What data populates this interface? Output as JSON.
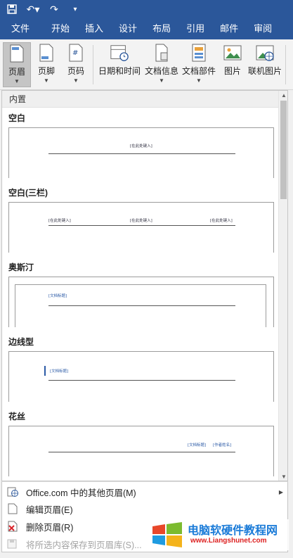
{
  "quick_access": {
    "save_icon": "save-icon",
    "undo_symbol": "↶▾",
    "redo_symbol": "↷",
    "customize_symbol": "▾"
  },
  "tabs": [
    "文件",
    "开始",
    "插入",
    "设计",
    "布局",
    "引用",
    "邮件",
    "审阅"
  ],
  "ribbon": {
    "buttons": [
      {
        "label": "页眉",
        "icon": "header-icon",
        "dropdown": true,
        "selected": true
      },
      {
        "label": "页脚",
        "icon": "footer-icon",
        "dropdown": true,
        "selected": false
      },
      {
        "label": "页码",
        "icon": "page-number-icon",
        "dropdown": true,
        "selected": false
      },
      {
        "label": "日期和时间",
        "icon": "date-time-icon",
        "dropdown": false,
        "selected": false
      },
      {
        "label": "文档信息",
        "icon": "document-info-icon",
        "dropdown": true,
        "selected": false
      },
      {
        "label": "文档部件",
        "icon": "quick-parts-icon",
        "dropdown": true,
        "selected": false
      },
      {
        "label": "图片",
        "icon": "picture-icon",
        "dropdown": false,
        "selected": false
      },
      {
        "label": "联机图片",
        "icon": "online-picture-icon",
        "dropdown": false,
        "selected": false
      }
    ]
  },
  "gallery": {
    "section_header": "内置",
    "items": [
      {
        "name": "空白",
        "placeholders": [
          "[在此处键入]"
        ]
      },
      {
        "name": "空白(三栏)",
        "placeholders": [
          "[在此处键入]",
          "[在此处键入]",
          "[在此处键入]"
        ]
      },
      {
        "name": "奥斯汀",
        "placeholders": [
          "[文档标题]"
        ]
      },
      {
        "name": "边线型",
        "placeholders": [
          "[文档标题]"
        ]
      },
      {
        "name": "花丝",
        "placeholders": [
          "[文档标题]",
          "[作者姓名]"
        ]
      }
    ]
  },
  "menu": {
    "items": [
      {
        "label": "Office.com 中的其他页眉(M)",
        "icon": "office-com-icon",
        "disabled": false,
        "submenu": true
      },
      {
        "label": "编辑页眉(E)",
        "icon": "edit-header-icon",
        "disabled": false,
        "submenu": false
      },
      {
        "label": "删除页眉(R)",
        "icon": "remove-header-icon",
        "disabled": false,
        "submenu": false,
        "highlighted": true
      },
      {
        "label": "将所选内容保存到页眉库(S)...",
        "icon": "save-to-gallery-icon",
        "disabled": true,
        "submenu": false
      }
    ]
  },
  "watermark": {
    "title": "电脑软硬件教程网",
    "url": "www.Liangshunet.com"
  },
  "colors": {
    "ribbon_blue": "#2b579a",
    "highlight_red": "#d9252b",
    "watermark_blue": "#1a7bd8"
  }
}
